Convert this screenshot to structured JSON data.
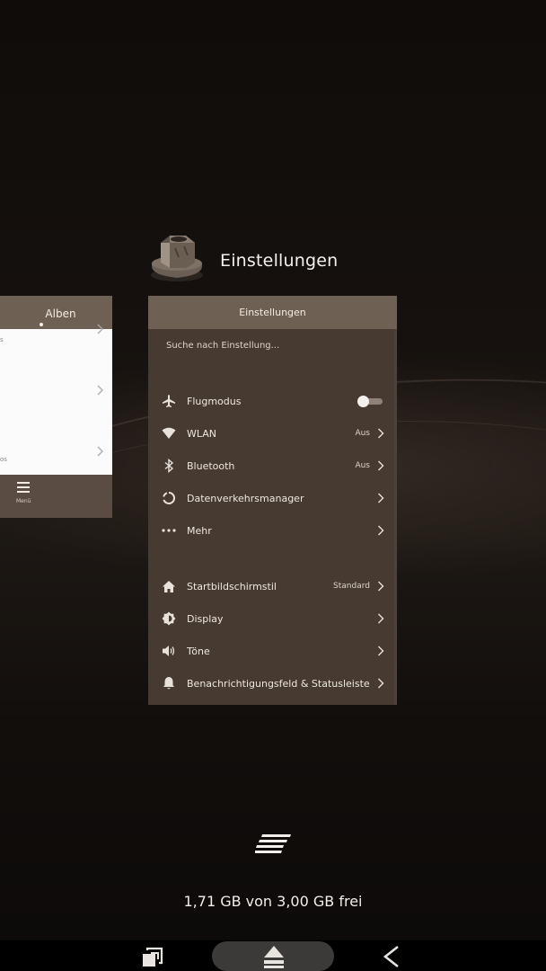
{
  "recent_apps": {
    "left_card": {
      "title": "Alben",
      "frag_top": "s",
      "frag_bottom": "os",
      "footer_label": "Menü"
    },
    "main_app": {
      "name": "Einstellungen",
      "icon": "hex-nut-icon",
      "card_title": "Einstellungen",
      "search_placeholder": "Suche nach Einstellung...",
      "items": [
        {
          "label": "Flugmodus",
          "icon": "airplane-icon",
          "toggle": "off"
        },
        {
          "label": "WLAN",
          "icon": "wifi-icon",
          "value": "Aus"
        },
        {
          "label": "Bluetooth",
          "icon": "bluetooth-icon",
          "value": "Aus"
        },
        {
          "label": "Datenverkehrsmanager",
          "icon": "data-usage-icon"
        },
        {
          "label": "Mehr",
          "icon": "more-dots-icon"
        },
        {
          "label": "Startbildschirmstil",
          "icon": "home-icon",
          "value": "Standard"
        },
        {
          "label": "Display",
          "icon": "brightness-icon"
        },
        {
          "label": "Töne",
          "icon": "speaker-icon"
        },
        {
          "label": "Benachrichtigungsfeld & Statusleiste",
          "icon": "bell-icon"
        }
      ]
    }
  },
  "memory": "1,71 GB von 3,00 GB frei",
  "nav": {
    "recents": "recents-icon",
    "home": "home-eject-icon",
    "back": "back-icon"
  },
  "colors": {
    "card_header": "#6e6053",
    "card_body": "#463a31",
    "background": "#16110e"
  }
}
